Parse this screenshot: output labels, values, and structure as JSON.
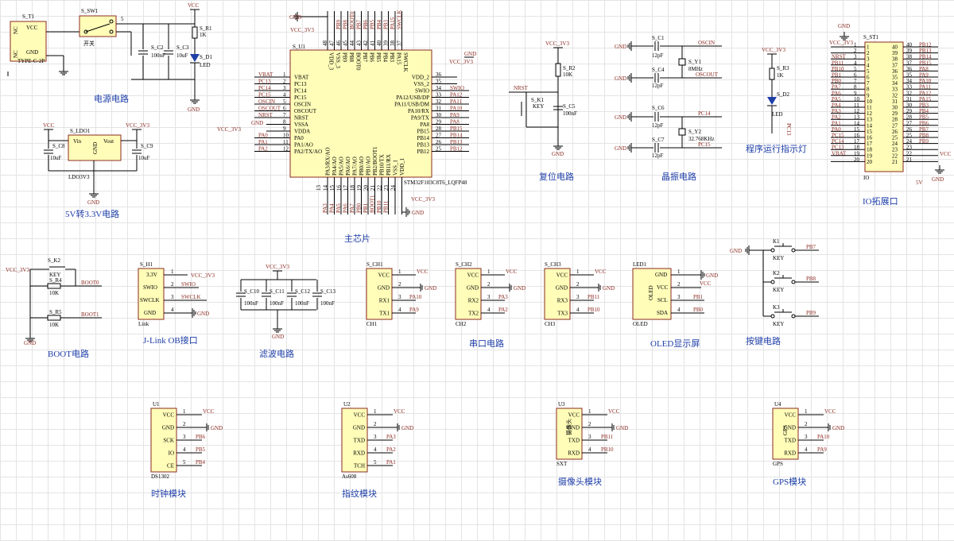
{
  "sections": {
    "power": "电源电路",
    "ldo": "5V转3.3V电路",
    "mcu": "主芯片",
    "reset": "复位电路",
    "crystal": "晶振电路",
    "led": "程序运行指示灯",
    "io": "IO拓展口",
    "boot": "BOOT电路",
    "jlink": "J-Link OB接口",
    "filter": "滤波电路",
    "uart": "串口电路",
    "oled": "OLED显示屏",
    "keys": "按键电路",
    "clock": "时钟模块",
    "finger": "指纹模块",
    "camera": "摄像头模块",
    "gps": "GPS模块"
  },
  "power": {
    "t1_ref": "S_T1",
    "t1_type": "TYPE-C-2P",
    "t1_vcc": "VCC",
    "t1_gnd": "GND",
    "t1_nc1": "NC",
    "t1_nc2": "NC",
    "sw_ref": "S_SW1",
    "sw_val": "开关",
    "c2_ref": "S_C2",
    "c2_val": "100nF",
    "c3_ref": "S_C3",
    "c3_val": "10uF",
    "r1_ref": "S_R1",
    "r1_val": "1K",
    "d1_ref": "S_D1",
    "d1_val": "LED",
    "vcc": "VCC",
    "gnd": "GND",
    "p1": "1",
    "p2": "2",
    "p3": "3",
    "p4": "4",
    "p5": "5",
    "p6": "6"
  },
  "ldo": {
    "ref": "S_LDO1",
    "vin": "Vin",
    "gnd": "GND",
    "vout": "Vout",
    "name": "LDO3V3",
    "c8_ref": "S_C8",
    "c8_val": "10uF",
    "c9_ref": "S_C9",
    "c9_val": "10uF",
    "vcc": "VCC",
    "vcc33": "VCC_3V3",
    "gnd_net": "GND"
  },
  "mcu": {
    "ref": "S_U1",
    "part": "STM32F103C8T6_LQFP48",
    "vcc33_top": "VCC_3V3",
    "gnd_top": "GND",
    "vcc33_r": "VCC_3V3",
    "gnd_r": "GND",
    "vcc33_l": "VCC_3V3",
    "gnd_l": "GND",
    "vcc33_b": "VCC_3V3",
    "gnd_b": "GND",
    "left": [
      {
        "nm": "VBAT",
        "n": "1",
        "net": "VBAT"
      },
      {
        "nm": "PC13",
        "n": "2",
        "net": "PC13"
      },
      {
        "nm": "PC14",
        "n": "3",
        "net": "PC14"
      },
      {
        "nm": "PC15",
        "n": "4",
        "net": "PC15"
      },
      {
        "nm": "OSCIN",
        "n": "5",
        "net": "OSCIN"
      },
      {
        "nm": "OSCOUT",
        "n": "6",
        "net": "OSCOUT"
      },
      {
        "nm": "NRST",
        "n": "7",
        "net": "NRST"
      },
      {
        "nm": "VSSA",
        "n": "8",
        "net": ""
      },
      {
        "nm": "VDDA",
        "n": "9",
        "net": ""
      },
      {
        "nm": "PA0",
        "n": "10",
        "net": "PA0"
      },
      {
        "nm": "PA1/AO",
        "n": "11",
        "net": "PA1"
      },
      {
        "nm": "PA2/TX/AO",
        "n": "12",
        "net": "PA2"
      }
    ],
    "right": [
      {
        "nm": "VDD_2",
        "n": "36",
        "net": ""
      },
      {
        "nm": "VSS_2",
        "n": "35",
        "net": ""
      },
      {
        "nm": "SWIO",
        "n": "34",
        "net": "SWIO"
      },
      {
        "nm": "PA12/USB/DP",
        "n": "33",
        "net": "PA12"
      },
      {
        "nm": "PA11/USB/DM",
        "n": "32",
        "net": "PA11"
      },
      {
        "nm": "PA10/RX",
        "n": "31",
        "net": "PA10"
      },
      {
        "nm": "PA9/TX",
        "n": "30",
        "net": "PA9"
      },
      {
        "nm": "PA8",
        "n": "29",
        "net": "PA8"
      },
      {
        "nm": "PB15",
        "n": "28",
        "net": "PB15"
      },
      {
        "nm": "PB14",
        "n": "27",
        "net": "PB14"
      },
      {
        "nm": "PB13",
        "n": "26",
        "net": "PB13"
      },
      {
        "nm": "PB12",
        "n": "25",
        "net": "PB12"
      }
    ],
    "top": [
      {
        "nm": "VDD_3",
        "n": "48",
        "net": ""
      },
      {
        "nm": "VSS_3",
        "n": "47",
        "net": ""
      },
      {
        "nm": "PB9",
        "n": "46",
        "net": "PB9"
      },
      {
        "nm": "PB8",
        "n": "45",
        "net": "PB8"
      },
      {
        "nm": "BOOT0",
        "n": "44",
        "net": "BOOT0"
      },
      {
        "nm": "PB7",
        "n": "43",
        "net": "PB7"
      },
      {
        "nm": "PB6",
        "n": "42",
        "net": "PB6"
      },
      {
        "nm": "PB5",
        "n": "41",
        "net": "PB5"
      },
      {
        "nm": "PB4",
        "n": "40",
        "net": "PB4"
      },
      {
        "nm": "PB3",
        "n": "39",
        "net": "PB3"
      },
      {
        "nm": "PA15",
        "n": "38",
        "net": "PA15"
      },
      {
        "nm": "SWCLK",
        "n": "37",
        "net": "SWCLK"
      }
    ],
    "bottom": [
      {
        "nm": "PA3/RX/AO",
        "n": "13",
        "net": "PA3"
      },
      {
        "nm": "PA4/AO",
        "n": "14",
        "net": "PA4"
      },
      {
        "nm": "PA5/AO",
        "n": "15",
        "net": "PA5"
      },
      {
        "nm": "PA6/AO",
        "n": "16",
        "net": "PA6"
      },
      {
        "nm": "PA7/AO",
        "n": "17",
        "net": "PA7"
      },
      {
        "nm": "PB0/AO",
        "n": "18",
        "net": "PB0"
      },
      {
        "nm": "PB1/AO",
        "n": "19",
        "net": "PB1"
      },
      {
        "nm": "PB2/BOOT1",
        "n": "20",
        "net": "BOOT1"
      },
      {
        "nm": "PB10/TX",
        "n": "21",
        "net": "PB10"
      },
      {
        "nm": "PB11/RX",
        "n": "22",
        "net": "PB11"
      },
      {
        "nm": "VSS_1",
        "n": "23",
        "net": ""
      },
      {
        "nm": "VDD_1",
        "n": "24",
        "net": ""
      }
    ]
  },
  "reset": {
    "vcc": "VCC_3V3",
    "r2_ref": "S_R2",
    "r2_val": "10K",
    "nrst": "NRST",
    "k1_ref": "S_K1",
    "k1_val": "KEY",
    "c5_ref": "S_C5",
    "c5_val": "100nF",
    "gnd": "GND"
  },
  "crystal": {
    "c1_ref": "S_C1",
    "c1_val": "12pF",
    "c4_ref": "S_C4",
    "c4_val": "12pF",
    "c6_ref": "S_C6",
    "c6_val": "12pF",
    "c7_ref": "S_C7",
    "c7_val": "12pF",
    "y1_ref": "S_Y1",
    "y1_val": "8MHz",
    "y2_ref": "S_Y2",
    "y2_val": "32.768KHz",
    "oscin": "OSCIN",
    "oscout": "OSCOUT",
    "pc14": "PC14",
    "pc15": "PC15",
    "gnd": "GND"
  },
  "led": {
    "vcc": "VCC_3V3",
    "r3_ref": "S_R3",
    "r3_val": "1K",
    "d2_ref": "S_D2",
    "d2_val": "LED",
    "net": "PC13"
  },
  "io": {
    "ref": "S_ST1",
    "name": "IO",
    "vcc33": "VCC_3V3",
    "gnd": "GND",
    "v5": "5V",
    "vcc": "VCC",
    "rows": [
      {
        "l": "1",
        "r": "40",
        "ln": "",
        "rn": "PB12"
      },
      {
        "l": "2",
        "r": "39",
        "ln": "",
        "rn": "PB13"
      },
      {
        "l": "3",
        "r": "38",
        "ln": "NRST",
        "rn": "PB14"
      },
      {
        "l": "4",
        "r": "37",
        "ln": "PB11",
        "rn": "PB15"
      },
      {
        "l": "5",
        "r": "36",
        "ln": "PB10",
        "rn": "PA8"
      },
      {
        "l": "6",
        "r": "35",
        "ln": "PB1",
        "rn": "PA9"
      },
      {
        "l": "7",
        "r": "34",
        "ln": "PB0",
        "rn": "PA10"
      },
      {
        "l": "8",
        "r": "33",
        "ln": "PA7",
        "rn": "PA11"
      },
      {
        "l": "9",
        "r": "32",
        "ln": "PA6",
        "rn": "PA12"
      },
      {
        "l": "10",
        "r": "31",
        "ln": "PA5",
        "rn": "PA15"
      },
      {
        "l": "11",
        "r": "30",
        "ln": "PA4",
        "rn": "PB3"
      },
      {
        "l": "12",
        "r": "29",
        "ln": "PA3",
        "rn": "PB4"
      },
      {
        "l": "13",
        "r": "28",
        "ln": "PA2",
        "rn": "PB5"
      },
      {
        "l": "14",
        "r": "27",
        "ln": "PA1",
        "rn": "PB6"
      },
      {
        "l": "15",
        "r": "26",
        "ln": "PA0",
        "rn": "PB7"
      },
      {
        "l": "16",
        "r": "25",
        "ln": "PC15",
        "rn": "PB8"
      },
      {
        "l": "17",
        "r": "24",
        "ln": "PC14",
        "rn": "PB9"
      },
      {
        "l": "18",
        "r": "23",
        "ln": "PC13",
        "rn": ""
      },
      {
        "l": "19",
        "r": "22",
        "ln": "VBAT",
        "rn": ""
      },
      {
        "l": "20",
        "r": "21",
        "ln": "",
        "rn": ""
      }
    ]
  },
  "boot": {
    "vcc": "VCC_3V3",
    "k2_ref": "S_K2",
    "k2_val": "KEY",
    "r4_ref": "S_R4",
    "r4_val": "10K",
    "r5_ref": "S_R5",
    "r5_val": "10K",
    "boot0": "BOOT0",
    "boot1": "BOOT1",
    "gnd": "GND"
  },
  "jlink": {
    "ref": "S_H1",
    "v": "3.3V",
    "swio": "SWIO",
    "swclk": "SWCLK",
    "gnd": "GND",
    "name": "Link",
    "vcc33": "VCC_3V3",
    "p1": "1",
    "p2": "2",
    "p3": "3",
    "p4": "4"
  },
  "filter": {
    "vcc": "VCC_3V3",
    "gnd": "GND",
    "caps": [
      {
        "ref": "S_C10",
        "val": "100nF"
      },
      {
        "ref": "S_C11",
        "val": "100nF"
      },
      {
        "ref": "S_C12",
        "val": "100nF"
      },
      {
        "ref": "S_C13",
        "val": "100nF"
      }
    ]
  },
  "uart": [
    {
      "ref": "S_CH1",
      "name": "CH1",
      "rx": "RX1",
      "tx": "TX1",
      "rxn": "PA10",
      "txn": "PA9"
    },
    {
      "ref": "S_CH2",
      "name": "CH2",
      "rx": "RX2",
      "tx": "TX2",
      "rxn": "PA3",
      "txn": "PA2"
    },
    {
      "ref": "S_CH3",
      "name": "CH3",
      "rx": "RX3",
      "tx": "TX3",
      "rxn": "PB11",
      "txn": "PB10"
    }
  ],
  "uart_common": {
    "vcc": "VCC",
    "gnd": "GND",
    "p1": "1",
    "p2": "2",
    "p3": "3",
    "p4": "4"
  },
  "oled": {
    "ref": "LED1",
    "name": "OLED",
    "gnd": "GND",
    "vcc": "VCC",
    "scl": "SCL",
    "sda": "SDA",
    "scln": "PB1",
    "sdan": "PB0",
    "label": "OLED"
  },
  "keys": {
    "gnd": "GND",
    "k1": "K1",
    "k2": "K2",
    "k3": "K3",
    "val": "KEY",
    "n1": "PB7",
    "n2": "PB8",
    "n3": "PB9"
  },
  "clock": {
    "ref": "U1",
    "name": "DS1302",
    "pins": [
      {
        "nm": "VCC",
        "n": "1",
        "net": "VCC"
      },
      {
        "nm": "GND",
        "n": "2",
        "net": "GND"
      },
      {
        "nm": "SCK",
        "n": "3",
        "net": "PB6"
      },
      {
        "nm": "IO",
        "n": "4",
        "net": "PB5"
      },
      {
        "nm": "CE",
        "n": "5",
        "net": "PB4"
      }
    ]
  },
  "finger": {
    "ref": "U2",
    "name": "As608",
    "pins": [
      {
        "nm": "VCC",
        "n": "1",
        "net": "VCC"
      },
      {
        "nm": "GND",
        "n": "2",
        "net": "GND"
      },
      {
        "nm": "TXD",
        "n": "3",
        "net": "PA3"
      },
      {
        "nm": "RXD",
        "n": "4",
        "net": "PA2"
      },
      {
        "nm": "TCH",
        "n": "5",
        "net": "PA1"
      }
    ]
  },
  "camera": {
    "ref": "U3",
    "name": "SXT",
    "label": "摄像头",
    "pins": [
      {
        "nm": "VCC",
        "n": "1",
        "net": "VCC"
      },
      {
        "nm": "GND",
        "n": "2",
        "net": "GND"
      },
      {
        "nm": "TXD",
        "n": "3",
        "net": "PB11"
      },
      {
        "nm": "RXD",
        "n": "4",
        "net": "PB10"
      }
    ]
  },
  "gps": {
    "ref": "U4",
    "name": "GPS",
    "label": "GPS",
    "pins": [
      {
        "nm": "VCC",
        "n": "1",
        "net": "VCC"
      },
      {
        "nm": "GND",
        "n": "2",
        "net": "GND"
      },
      {
        "nm": "TXD",
        "n": "3",
        "net": "PA10"
      },
      {
        "nm": "RXD",
        "n": "4",
        "net": "PA9"
      }
    ]
  }
}
